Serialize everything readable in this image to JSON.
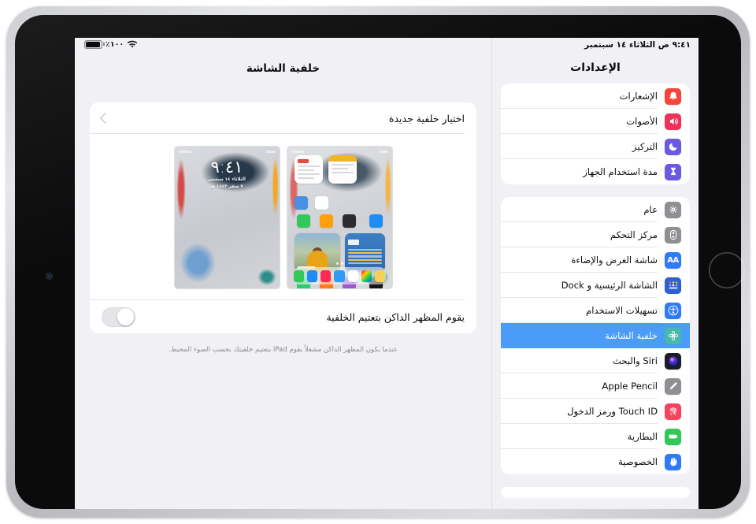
{
  "statusbar": {
    "datetime": "٩:٤١ ص الثلاثاء ١٤ سبتمبر",
    "battery_percent": "٪١٠٠",
    "battery_icon": "battery-icon",
    "wifi_icon": "wifi-icon"
  },
  "sidebar": {
    "title": "الإعدادات",
    "groups": [
      {
        "items": [
          {
            "label": "الإشعارات",
            "icon": "notifications-bell-icon",
            "color": "#f4453c"
          },
          {
            "label": "الأصوات",
            "icon": "sounds-speaker-icon",
            "color": "#f0325b"
          },
          {
            "label": "التركيز",
            "icon": "focus-moon-icon",
            "color": "#6a5ae0"
          },
          {
            "label": "مدة استخدام الجهاز",
            "icon": "screen-time-hourglass-icon",
            "color": "#6a5ae0"
          }
        ]
      },
      {
        "items": [
          {
            "label": "عام",
            "icon": "general-gear-icon",
            "color": "#8e8e93"
          },
          {
            "label": "مركز التحكم",
            "icon": "control-center-toggles-icon",
            "color": "#8e8e93"
          },
          {
            "label": "شاشة العرض والإضاءة",
            "icon": "display-brightness-aa-icon",
            "color": "#2f7bf6"
          },
          {
            "label": "الشاشة الرئيسية و Dock",
            "icon": "home-screen-dock-grid-icon",
            "color": "#2f5fd0"
          },
          {
            "label": "تسهيلات الاستخدام",
            "icon": "accessibility-icon",
            "color": "#2f7bf6"
          },
          {
            "label": "خلفية الشاشة",
            "icon": "wallpaper-flower-icon",
            "color": "#46b9a8",
            "selected": true
          },
          {
            "label": "Siri والبحث",
            "icon": "siri-orb-icon",
            "color": "#1c1c28"
          },
          {
            "label": "Apple Pencil",
            "icon": "apple-pencil-icon",
            "color": "#8e8e93"
          },
          {
            "label": "Touch ID ورمز الدخول",
            "icon": "touch-id-fingerprint-icon",
            "color": "#f4435c"
          },
          {
            "label": "البطارية",
            "icon": "battery-green-icon",
            "color": "#32c759"
          },
          {
            "label": "الخصوصية",
            "icon": "privacy-hand-icon",
            "color": "#2f7bf6"
          }
        ]
      }
    ]
  },
  "detail": {
    "title": "خلفية الشاشة",
    "choose_new_row": {
      "label": "اختيار خلفية جديدة",
      "chevron_icon": "chevron-back-icon"
    },
    "wallpapers": [
      {
        "name": "home-screen-preview",
        "caption": ""
      },
      {
        "name": "lock-screen-preview",
        "caption": ""
      }
    ],
    "lock_preview": {
      "time": "٩:٤١",
      "date_line1": "الثلاثاء ١٤ سبتمبر",
      "date_line2": "٧ صفر ١٤٤٣ هـ"
    },
    "dark_appearance_row": {
      "label": "يقوم المظهر الداكن بتعتيم الخلفية",
      "toggle_state": "off"
    },
    "footnote": "عندما يكون المظهر الداكن مشغلاً يقوم iPad بتعتيم خلفيتك بحسب الضوء المحيط."
  },
  "colors": {
    "accent": "#4a9cf8",
    "screen_background": "#f1f1f5",
    "card": "#ffffff"
  }
}
